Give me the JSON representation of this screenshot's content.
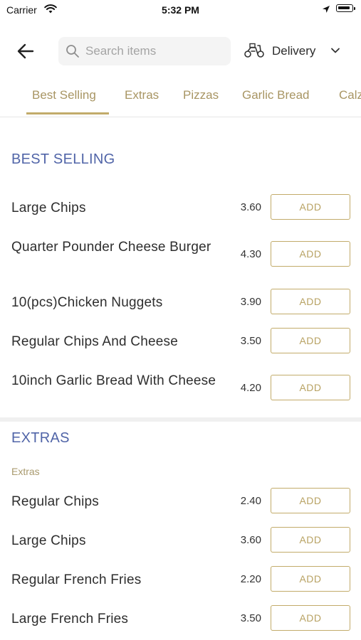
{
  "status_bar": {
    "carrier": "Carrier",
    "time": "5:32 PM"
  },
  "header": {
    "search_placeholder": "Search items",
    "delivery_label": "Delivery"
  },
  "tabs": [
    {
      "label": "Best Selling",
      "active": true
    },
    {
      "label": "Extras"
    },
    {
      "label": "Pizzas"
    },
    {
      "label": "Garlic Bread"
    },
    {
      "label": "Calzones"
    }
  ],
  "sections": [
    {
      "title": "BEST SELLING",
      "items": [
        {
          "name": "Large Chips",
          "price": "3.60",
          "button": "ADD"
        },
        {
          "name": "Quarter Pounder Cheese Burger",
          "price": "4.30",
          "button": "ADD"
        },
        {
          "name": "10(pcs)Chicken Nuggets",
          "price": "3.90",
          "button": "ADD"
        },
        {
          "name": "Regular Chips And Cheese",
          "price": "3.50",
          "button": "ADD"
        },
        {
          "name": "10inch Garlic Bread With Cheese",
          "price": "4.20",
          "button": "ADD"
        }
      ]
    },
    {
      "title": "EXTRAS",
      "subtitle": "Extras",
      "items": [
        {
          "name": "Regular Chips",
          "price": "2.40",
          "button": "ADD"
        },
        {
          "name": "Large Chips",
          "price": "3.60",
          "button": "ADD"
        },
        {
          "name": "Regular French Fries",
          "price": "2.20",
          "button": "ADD"
        },
        {
          "name": "Large French Fries",
          "price": "3.50",
          "button": "ADD"
        }
      ]
    }
  ],
  "colors": {
    "accent_gold": "#c2ab6a",
    "section_blue": "#5165a8"
  },
  "icons": [
    "wifi-icon",
    "location-arrow-icon",
    "battery-icon",
    "back-arrow-icon",
    "search-icon",
    "scooter-icon",
    "chevron-down-icon"
  ]
}
